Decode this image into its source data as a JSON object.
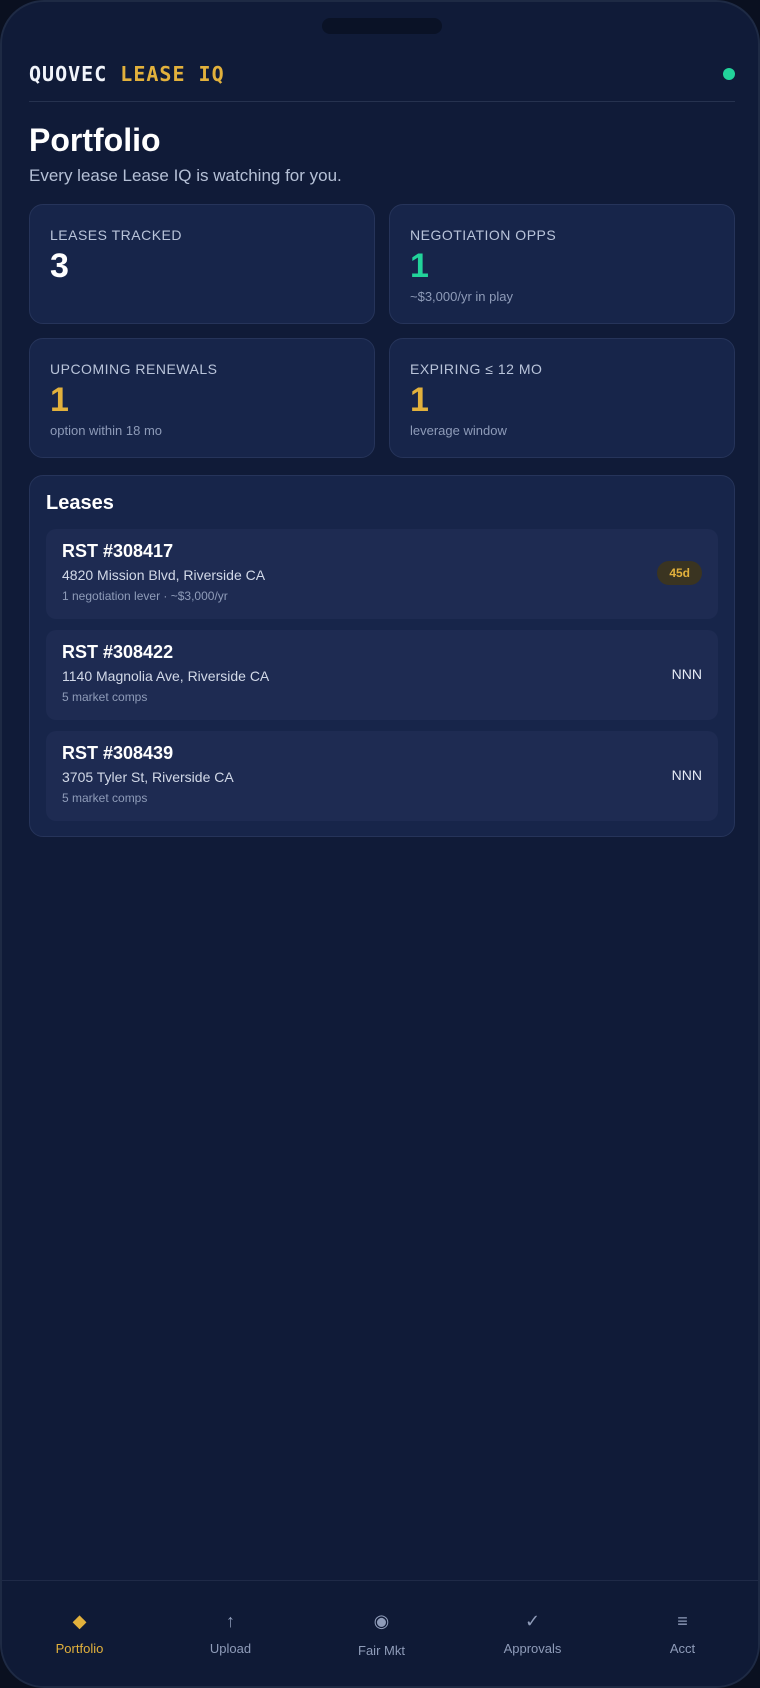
{
  "header": {
    "brand_main": "QUOVEC",
    "brand_accent": "LEASE IQ",
    "status_color": "#22d39a"
  },
  "page": {
    "title": "Portfolio",
    "subtitle": "Every lease Lease IQ is watching for you."
  },
  "stats": [
    {
      "label": "LEASES TRACKED",
      "value": "3",
      "note": "",
      "color": "#ffffff"
    },
    {
      "label": "NEGOTIATION OPPS",
      "value": "1",
      "note": "~$3,000/yr in play",
      "color": "#22d39a"
    },
    {
      "label": "UPCOMING RENEWALS",
      "value": "1",
      "note": "option within 18 mo",
      "color": "#e2b13c"
    },
    {
      "label": "EXPIRING ≤ 12 MO",
      "value": "1",
      "note": "leverage window",
      "color": "#e2b13c"
    }
  ],
  "leases": {
    "title": "Leases",
    "items": [
      {
        "id": "RST #308417",
        "address": "4820 Mission Blvd, Riverside CA",
        "note": "1 negotiation lever · ~$3,000/yr",
        "badge": "45d"
      },
      {
        "id": "RST #308422",
        "address": "1140 Magnolia Ave, Riverside CA",
        "note": "5 market comps",
        "tag": "NNN"
      },
      {
        "id": "RST #308439",
        "address": "3705 Tyler St, Riverside CA",
        "note": "5 market comps",
        "tag": "NNN"
      }
    ]
  },
  "nav": [
    {
      "label": "Portfolio",
      "icon": "diamond-icon",
      "glyph": "◆",
      "active": true
    },
    {
      "label": "Upload",
      "icon": "upload-arrow-icon",
      "glyph": "↑",
      "active": false
    },
    {
      "label": "Fair Mkt",
      "icon": "target-icon",
      "glyph": "◉",
      "active": false
    },
    {
      "label": "Approvals",
      "icon": "check-icon",
      "glyph": "✓",
      "active": false
    },
    {
      "label": "Acct",
      "icon": "menu-icon",
      "glyph": "≡",
      "active": false
    }
  ],
  "colors": {
    "accent": "#e2b13c",
    "positive": "#22d39a",
    "background": "#101b38"
  }
}
